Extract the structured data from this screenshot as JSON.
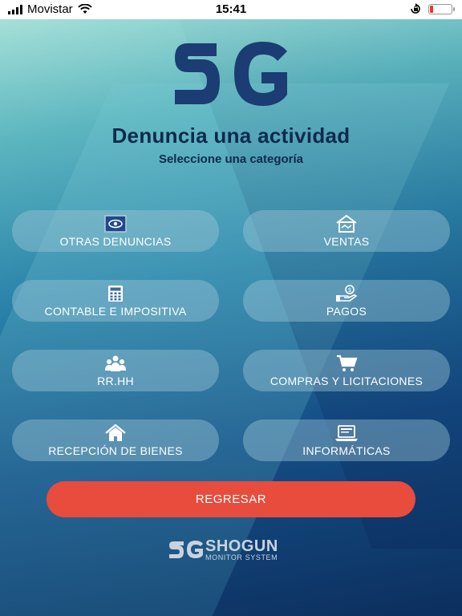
{
  "status_bar": {
    "carrier": "Movistar",
    "time": "15:41",
    "battery_level": 0.15
  },
  "header": {
    "title": "Denuncia una actividad",
    "subtitle": "Seleccione una categoría"
  },
  "categories": [
    {
      "label": "OTRAS DENUNCIAS",
      "icon": "eye-document-icon"
    },
    {
      "label": "VENTAS",
      "icon": "handshake-house-icon"
    },
    {
      "label": "CONTABLE E IMPOSITIVA",
      "icon": "calculator-icon"
    },
    {
      "label": "PAGOS",
      "icon": "hand-coin-icon"
    },
    {
      "label": "RR.HH",
      "icon": "people-group-icon"
    },
    {
      "label": "COMPRAS Y LICITACIONES",
      "icon": "shopping-cart-icon"
    },
    {
      "label": "RECEPCIÓN DE BIENES",
      "icon": "home-icon"
    },
    {
      "label": "INFORMÁTICAS",
      "icon": "laptop-icon"
    }
  ],
  "back_button": {
    "label": "REGRESAR"
  },
  "footer": {
    "brand": "SHOGUN",
    "tagline": "MONITOR SYSTEM"
  },
  "colors": {
    "accent": "#e84c3d",
    "title": "#0e2a4c",
    "logo": "#1b3d73"
  }
}
